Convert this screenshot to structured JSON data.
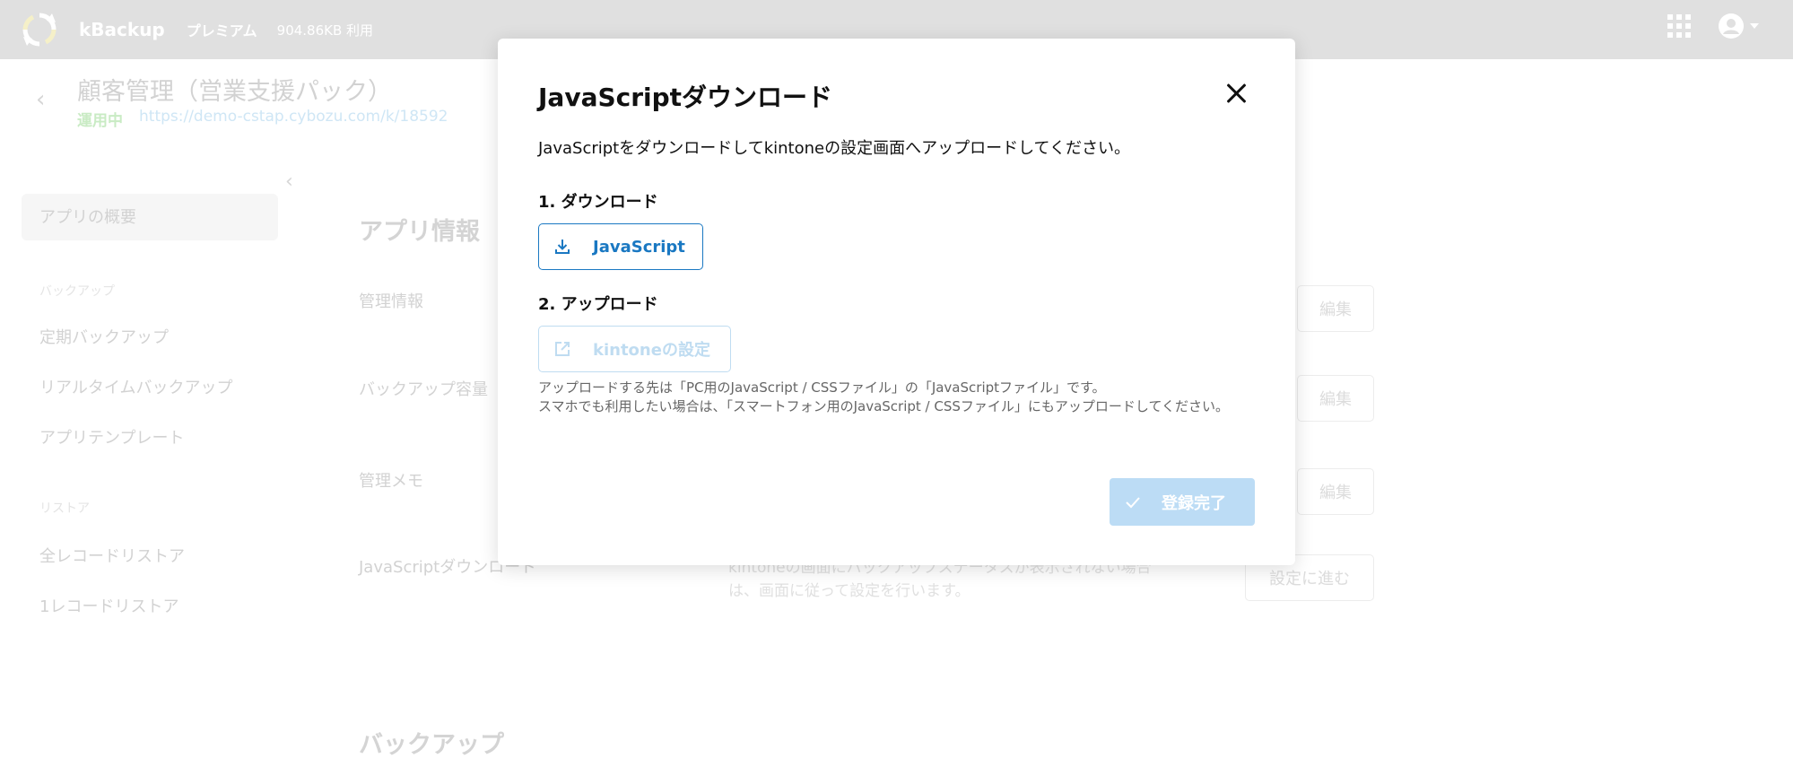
{
  "topbar": {
    "brand": "kBackup",
    "plan": "プレミアム",
    "usage": "904.86KB 利用"
  },
  "app": {
    "title": "顧客管理（営業支援パック）",
    "status": "運用中",
    "url": "https://demo-cstap.cybozu.com/k/18592"
  },
  "sidebar": {
    "overview": "アプリの概要",
    "section_backup": "バックアップ",
    "items_backup": [
      "定期バックアップ",
      "リアルタイムバックアップ",
      "アプリテンプレート"
    ],
    "section_restore": "リストア",
    "items_restore": [
      "全レコードリストア",
      "1レコードリストア"
    ]
  },
  "main": {
    "heading": "アプリ情報",
    "rows": [
      {
        "label": "管理情報",
        "button": "編集"
      },
      {
        "label": "バックアップ容量",
        "button": "編集"
      },
      {
        "label": "管理メモ",
        "button": "編集"
      },
      {
        "label": "JavaScriptダウンロード",
        "desc1": "kintoneの画面にバックアップステータスが表示されない場合",
        "desc2": "は、画面に従って設定を行います。",
        "button": "設定に進む"
      }
    ],
    "bottom_heading": "バックアップ"
  },
  "modal": {
    "title": "JavaScriptダウンロード",
    "description": "JavaScriptをダウンロードしてkintoneの設定画面へアップロードしてください。",
    "step1": "1. ダウンロード",
    "download_label": "JavaScript",
    "step2": "2. アップロード",
    "kintone_label": "kintoneの設定",
    "note1": "アップロードする先は「PC用のJavaScript / CSSファイル」の「JavaScriptファイル」です。",
    "note2": "スマホでも利用したい場合は、「スマートフォン用のJavaScript / CSSファイル」にもアップロードしてください。",
    "done_label": "登録完了"
  },
  "colors": {
    "primary": "#1a78c2",
    "primary_disabled": "#bcdcf5",
    "topbar": "#e0e0e0"
  }
}
